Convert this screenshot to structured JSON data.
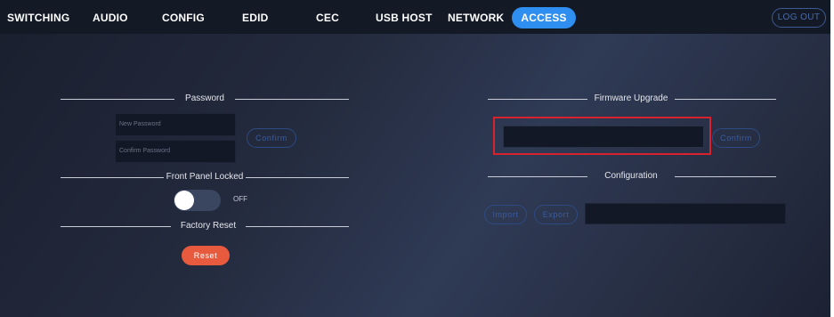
{
  "nav": {
    "items": [
      {
        "label": "SWITCHING"
      },
      {
        "label": "AUDIO"
      },
      {
        "label": "CONFIG"
      },
      {
        "label": "EDID"
      },
      {
        "label": "CEC"
      },
      {
        "label": "USB HOST"
      },
      {
        "label": "NETWORK"
      },
      {
        "label": "ACCESS",
        "active": true
      }
    ],
    "logout_label": "LOG OUT"
  },
  "password": {
    "title": "Password",
    "new_placeholder": "New Password",
    "confirm_placeholder": "Confirm Password",
    "confirm_button": "Confirm"
  },
  "front_panel": {
    "title": "Front Panel Locked",
    "toggle_state": "OFF"
  },
  "factory_reset": {
    "title": "Factory Reset",
    "reset_button": "Reset"
  },
  "firmware": {
    "title": "Firmware Upgrade",
    "confirm_button": "Confirm"
  },
  "configuration": {
    "title": "Configuration",
    "import_button": "Import",
    "export_button": "Export"
  },
  "colors": {
    "accent": "#2f8ff0",
    "reset": "#e85a3e",
    "highlight": "#d8232e"
  }
}
